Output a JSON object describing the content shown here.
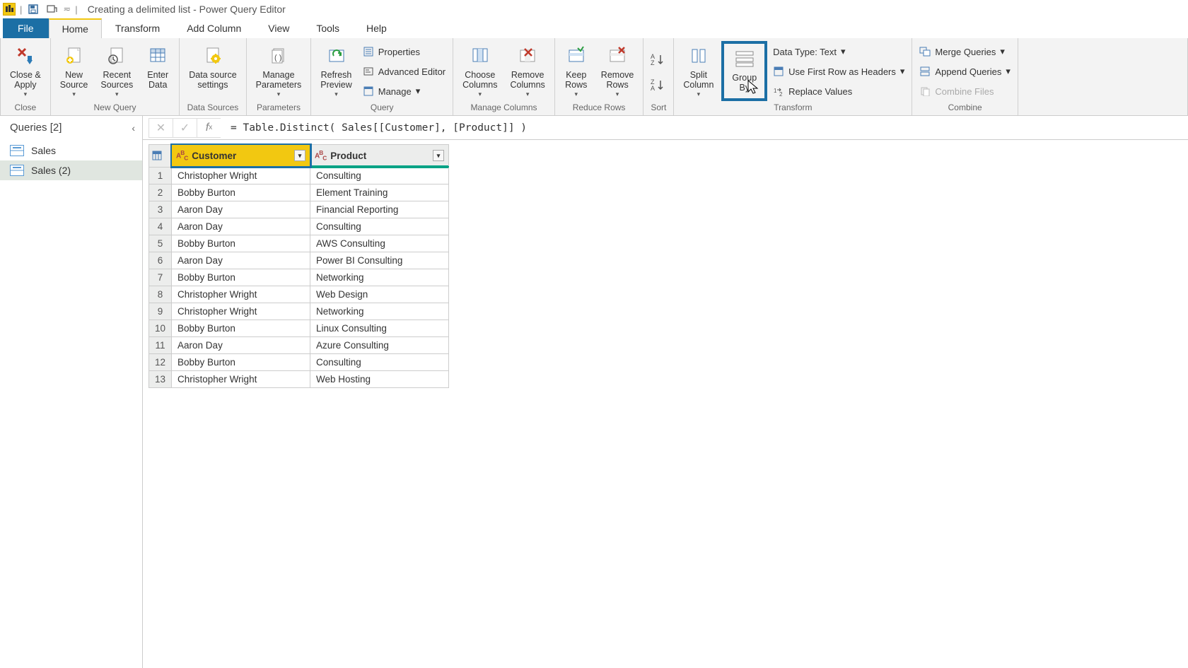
{
  "titlebar": {
    "title": "Creating a delimited list - Power Query Editor"
  },
  "tabs": {
    "file": "File",
    "home": "Home",
    "transform": "Transform",
    "add_column": "Add Column",
    "view": "View",
    "tools": "Tools",
    "help": "Help"
  },
  "ribbon": {
    "close_group": {
      "close_apply": "Close &\nApply",
      "label": "Close"
    },
    "new_query": {
      "new_source": "New\nSource",
      "recent_sources": "Recent\nSources",
      "enter_data": "Enter\nData",
      "label": "New Query"
    },
    "data_sources": {
      "settings": "Data source\nsettings",
      "label": "Data Sources"
    },
    "parameters": {
      "manage": "Manage\nParameters",
      "label": "Parameters"
    },
    "query": {
      "refresh": "Refresh\nPreview",
      "properties": "Properties",
      "advanced": "Advanced Editor",
      "manage": "Manage",
      "label": "Query"
    },
    "manage_cols": {
      "choose": "Choose\nColumns",
      "remove": "Remove\nColumns",
      "label": "Manage Columns"
    },
    "reduce_rows": {
      "keep": "Keep\nRows",
      "remove": "Remove\nRows",
      "label": "Reduce Rows"
    },
    "sort": {
      "label": "Sort"
    },
    "transform": {
      "split": "Split\nColumn",
      "group_by": "Group\nBy",
      "data_type": "Data Type: Text",
      "first_row": "Use First Row as Headers",
      "replace": "Replace Values",
      "label": "Transform"
    },
    "combine": {
      "merge": "Merge Queries",
      "append": "Append Queries",
      "combine_files": "Combine Files",
      "label": "Combine"
    }
  },
  "sidebar": {
    "header": "Queries [2]",
    "items": [
      {
        "label": "Sales"
      },
      {
        "label": "Sales (2)"
      }
    ]
  },
  "formula": "= Table.Distinct( Sales[[Customer], [Product]] )",
  "columns": {
    "customer": "Customer",
    "product": "Product"
  },
  "rows": [
    {
      "n": "1",
      "customer": "Christopher Wright",
      "product": "Consulting"
    },
    {
      "n": "2",
      "customer": "Bobby Burton",
      "product": "Element Training"
    },
    {
      "n": "3",
      "customer": "Aaron Day",
      "product": "Financial Reporting"
    },
    {
      "n": "4",
      "customer": "Aaron Day",
      "product": "Consulting"
    },
    {
      "n": "5",
      "customer": "Bobby Burton",
      "product": "AWS Consulting"
    },
    {
      "n": "6",
      "customer": "Aaron Day",
      "product": "Power BI Consulting"
    },
    {
      "n": "7",
      "customer": "Bobby Burton",
      "product": "Networking"
    },
    {
      "n": "8",
      "customer": "Christopher Wright",
      "product": "Web Design"
    },
    {
      "n": "9",
      "customer": "Christopher Wright",
      "product": "Networking"
    },
    {
      "n": "10",
      "customer": "Bobby Burton",
      "product": "Linux Consulting"
    },
    {
      "n": "11",
      "customer": "Aaron Day",
      "product": "Azure Consulting"
    },
    {
      "n": "12",
      "customer": "Bobby Burton",
      "product": "Consulting"
    },
    {
      "n": "13",
      "customer": "Christopher Wright",
      "product": "Web Hosting"
    }
  ]
}
